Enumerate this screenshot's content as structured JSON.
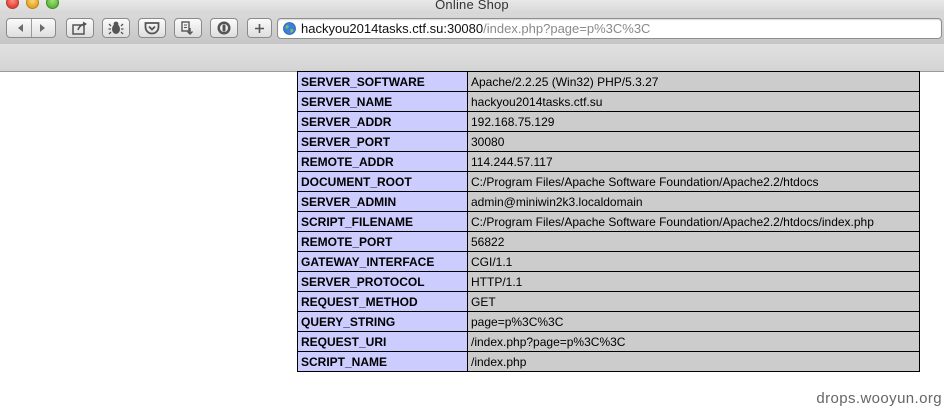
{
  "window": {
    "title": "Online Shop"
  },
  "toolbar": {
    "buttons": [
      {
        "icon": "back-arrow-icon"
      },
      {
        "icon": "forward-arrow-icon"
      },
      {
        "icon": "share-icon"
      },
      {
        "icon": "bug-icon"
      },
      {
        "icon": "pocket-icon"
      },
      {
        "icon": "downloads-icon"
      },
      {
        "icon": "shield-icon"
      },
      {
        "icon": "plus-icon"
      }
    ]
  },
  "address_bar": {
    "host": "hackyou2014tasks.ctf.su:30080",
    "path": "/index.php?page=p%3C%3C",
    "icon": "globe-icon"
  },
  "table": {
    "rows": [
      {
        "key": "SERVER_SOFTWARE",
        "value": "Apache/2.2.25 (Win32) PHP/5.3.27"
      },
      {
        "key": "SERVER_NAME",
        "value": "hackyou2014tasks.ctf.su"
      },
      {
        "key": "SERVER_ADDR",
        "value": "192.168.75.129"
      },
      {
        "key": "SERVER_PORT",
        "value": "30080"
      },
      {
        "key": "REMOTE_ADDR",
        "value": "114.244.57.117"
      },
      {
        "key": "DOCUMENT_ROOT",
        "value": "C:/Program Files/Apache Software Foundation/Apache2.2/htdocs"
      },
      {
        "key": "SERVER_ADMIN",
        "value": "admin@miniwin2k3.localdomain"
      },
      {
        "key": "SCRIPT_FILENAME",
        "value": "C:/Program Files/Apache Software Foundation/Apache2.2/htdocs/index.php"
      },
      {
        "key": "REMOTE_PORT",
        "value": "56822"
      },
      {
        "key": "GATEWAY_INTERFACE",
        "value": "CGI/1.1"
      },
      {
        "key": "SERVER_PROTOCOL",
        "value": "HTTP/1.1"
      },
      {
        "key": "REQUEST_METHOD",
        "value": "GET"
      },
      {
        "key": "QUERY_STRING",
        "value": "page=p%3C%3C"
      },
      {
        "key": "REQUEST_URI",
        "value": "/index.php?page=p%3C%3C"
      },
      {
        "key": "SCRIPT_NAME",
        "value": "/index.php"
      }
    ]
  },
  "watermark": "drops.wooyun.org",
  "colors": {
    "key_cell_bg": "#ccccff",
    "value_cell_bg": "#cccccc"
  }
}
